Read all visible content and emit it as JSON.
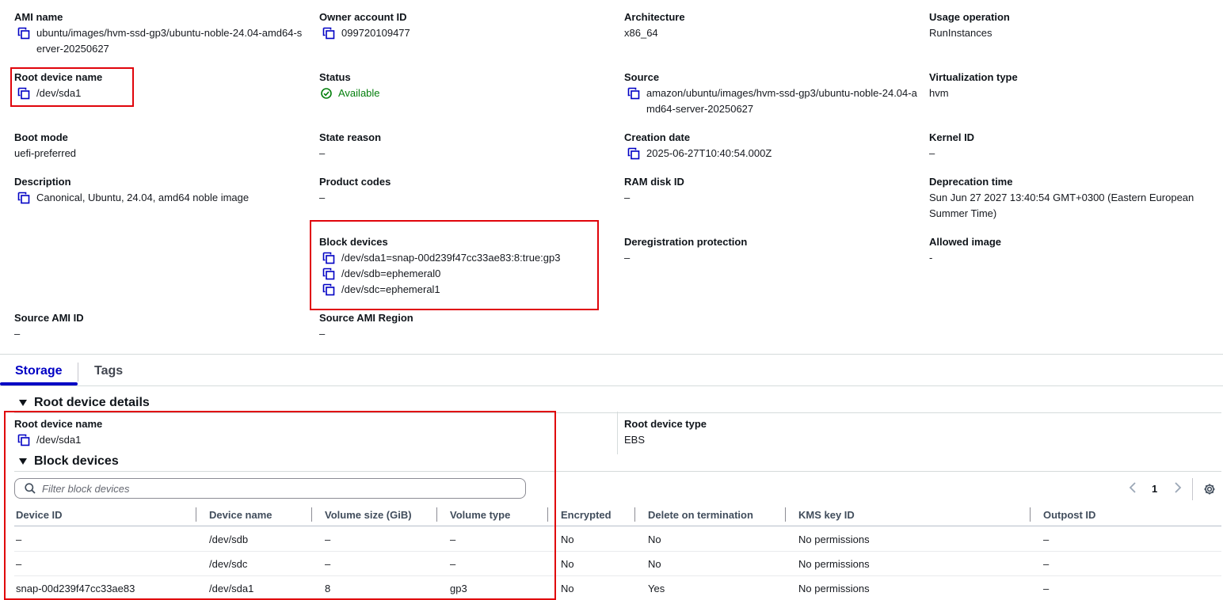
{
  "details": {
    "ami_name": {
      "label": "AMI name",
      "value": "ubuntu/images/hvm-ssd-gp3/ubuntu-noble-24.04-amd64-server-20250627"
    },
    "owner_account_id": {
      "label": "Owner account ID",
      "value": "099720109477"
    },
    "architecture": {
      "label": "Architecture",
      "value": "x86_64"
    },
    "usage_operation": {
      "label": "Usage operation",
      "value": "RunInstances"
    },
    "root_device_name": {
      "label": "Root device name",
      "value": "/dev/sda1"
    },
    "status": {
      "label": "Status",
      "value": "Available"
    },
    "source": {
      "label": "Source",
      "value": "amazon/ubuntu/images/hvm-ssd-gp3/ubuntu-noble-24.04-amd64-server-20250627"
    },
    "virtualization_type": {
      "label": "Virtualization type",
      "value": "hvm"
    },
    "boot_mode": {
      "label": "Boot mode",
      "value": "uefi-preferred"
    },
    "state_reason": {
      "label": "State reason",
      "value": "–"
    },
    "creation_date": {
      "label": "Creation date",
      "value": "2025-06-27T10:40:54.000Z"
    },
    "kernel_id": {
      "label": "Kernel ID",
      "value": "–"
    },
    "description": {
      "label": "Description",
      "value": "Canonical, Ubuntu, 24.04, amd64 noble image"
    },
    "product_codes": {
      "label": "Product codes",
      "value": "–"
    },
    "ram_disk_id": {
      "label": "RAM disk ID",
      "value": "–"
    },
    "deprecation_time": {
      "label": "Deprecation time",
      "value": "Sun Jun 27 2027 13:40:54 GMT+0300 (Eastern European Summer Time)"
    },
    "block_devices": {
      "label": "Block devices",
      "values": [
        "/dev/sda1=snap-00d239f47cc33ae83:8:true:gp3",
        "/dev/sdb=ephemeral0",
        "/dev/sdc=ephemeral1"
      ]
    },
    "deregistration_protection": {
      "label": "Deregistration protection",
      "value": "–"
    },
    "allowed_image": {
      "label": "Allowed image",
      "value": "-"
    },
    "source_ami_id": {
      "label": "Source AMI ID",
      "value": "–"
    },
    "source_ami_region": {
      "label": "Source AMI Region",
      "value": "–"
    }
  },
  "tabs": [
    "Storage",
    "Tags"
  ],
  "storage": {
    "root_section_title": "Root device details",
    "root_device_name": {
      "label": "Root device name",
      "value": "/dev/sda1"
    },
    "root_device_type": {
      "label": "Root device type",
      "value": "EBS"
    },
    "block_section_title": "Block devices",
    "filter_placeholder": "Filter block devices",
    "page": "1",
    "columns": [
      "Device ID",
      "Device name",
      "Volume size (GiB)",
      "Volume type",
      "Encrypted",
      "Delete on termination",
      "KMS key ID",
      "Outpost ID"
    ],
    "rows": [
      [
        "–",
        "/dev/sdb",
        "–",
        "–",
        "No",
        "No",
        "No permissions",
        "–"
      ],
      [
        "–",
        "/dev/sdc",
        "–",
        "–",
        "No",
        "No",
        "No permissions",
        "–"
      ],
      [
        "snap-00d239f47cc33ae83",
        "/dev/sda1",
        "8",
        "gp3",
        "No",
        "Yes",
        "No permissions",
        "–"
      ]
    ]
  },
  "colors": {
    "accent": "#0000c4",
    "highlight_box": "#e0040b",
    "status_ok": "#037f0c"
  },
  "icons": {
    "copy": "copy-icon",
    "status": "check-circle-icon",
    "search": "search-icon",
    "settings": "gear-icon"
  }
}
